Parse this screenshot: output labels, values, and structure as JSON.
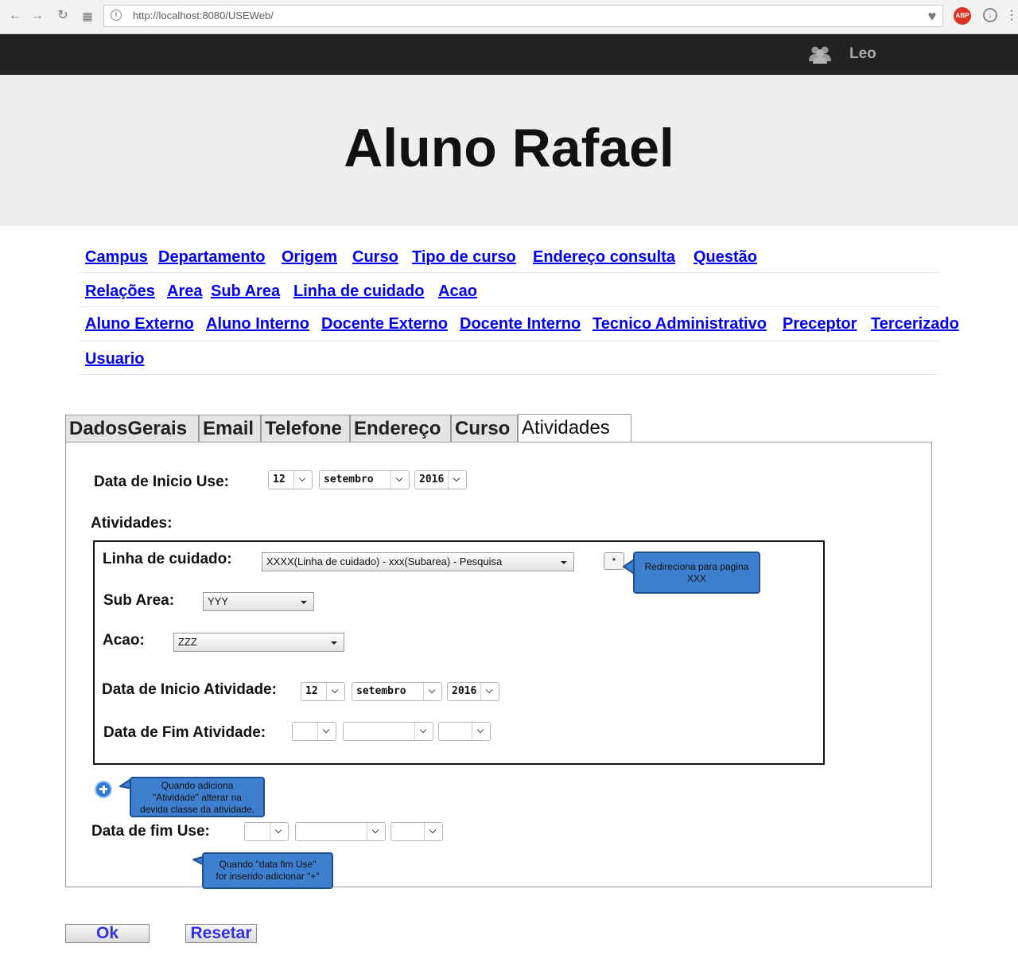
{
  "browser": {
    "url": "http://localhost:8080/USEWeb/",
    "abp_label": "ABP"
  },
  "topbar": {
    "user_name": "Leo"
  },
  "header": {
    "title": "Aluno Rafael"
  },
  "menu": {
    "row1": [
      "Campus",
      "Departamento",
      "Origem",
      "Curso",
      "Tipo de curso",
      "Endereço consulta",
      "Questão"
    ],
    "row2": [
      "Relações",
      "Area",
      "Sub Area",
      "Linha de cuidado",
      "Acao"
    ],
    "row3": [
      "Aluno Externo",
      "Aluno Interno",
      "Docente Externo",
      "Docente Interno",
      "Tecnico Administrativo",
      "Preceptor",
      "Tercerizado"
    ],
    "row4": [
      "Usuario"
    ]
  },
  "tabs": [
    "DadosGerais",
    "Email",
    "Telefone",
    "Endereço",
    "Curso",
    "Atividades"
  ],
  "active_tab": "Atividades",
  "form": {
    "data_inicio_use": {
      "label": "Data de Inicio Use:",
      "day": "12",
      "month": "setembro",
      "year": "2016"
    },
    "atividades_label": "Atividades:",
    "linha_cuidado": {
      "label": "Linha de cuidado:",
      "value": "XXXX(Linha de cuidado) - xxx(Subarea) - Pesquisa"
    },
    "star_button": "*",
    "sub_area": {
      "label": "Sub Area:",
      "value": "YYY"
    },
    "acao": {
      "label": "Acao:",
      "value": "ZZZ"
    },
    "data_inicio_atividade": {
      "label": "Data de Inicio Atividade:",
      "day": "12",
      "month": "setembro",
      "year": "2016"
    },
    "data_fim_atividade": {
      "label": "Data de Fim Atividade:",
      "day": "",
      "month": "",
      "year": ""
    },
    "data_fim_use": {
      "label": "Data de fim Use:",
      "day": "",
      "month": "",
      "year": ""
    }
  },
  "callouts": {
    "redireciona": [
      "Redireciona para pagina",
      "XXX"
    ],
    "adiciona": [
      "Quando adiciona",
      "\"Atividade\" alterar na",
      "devida classe da atividade."
    ],
    "data_fim": [
      "Quando \"data fim Use\"",
      "for inserido adicionar \"+\""
    ]
  },
  "buttons": {
    "ok": "Ok",
    "reset": "Resetar"
  },
  "colors": {
    "callout": "#3f7fcf",
    "link": "#0000ee",
    "topbar": "#222222",
    "header": "#eeeeee"
  }
}
